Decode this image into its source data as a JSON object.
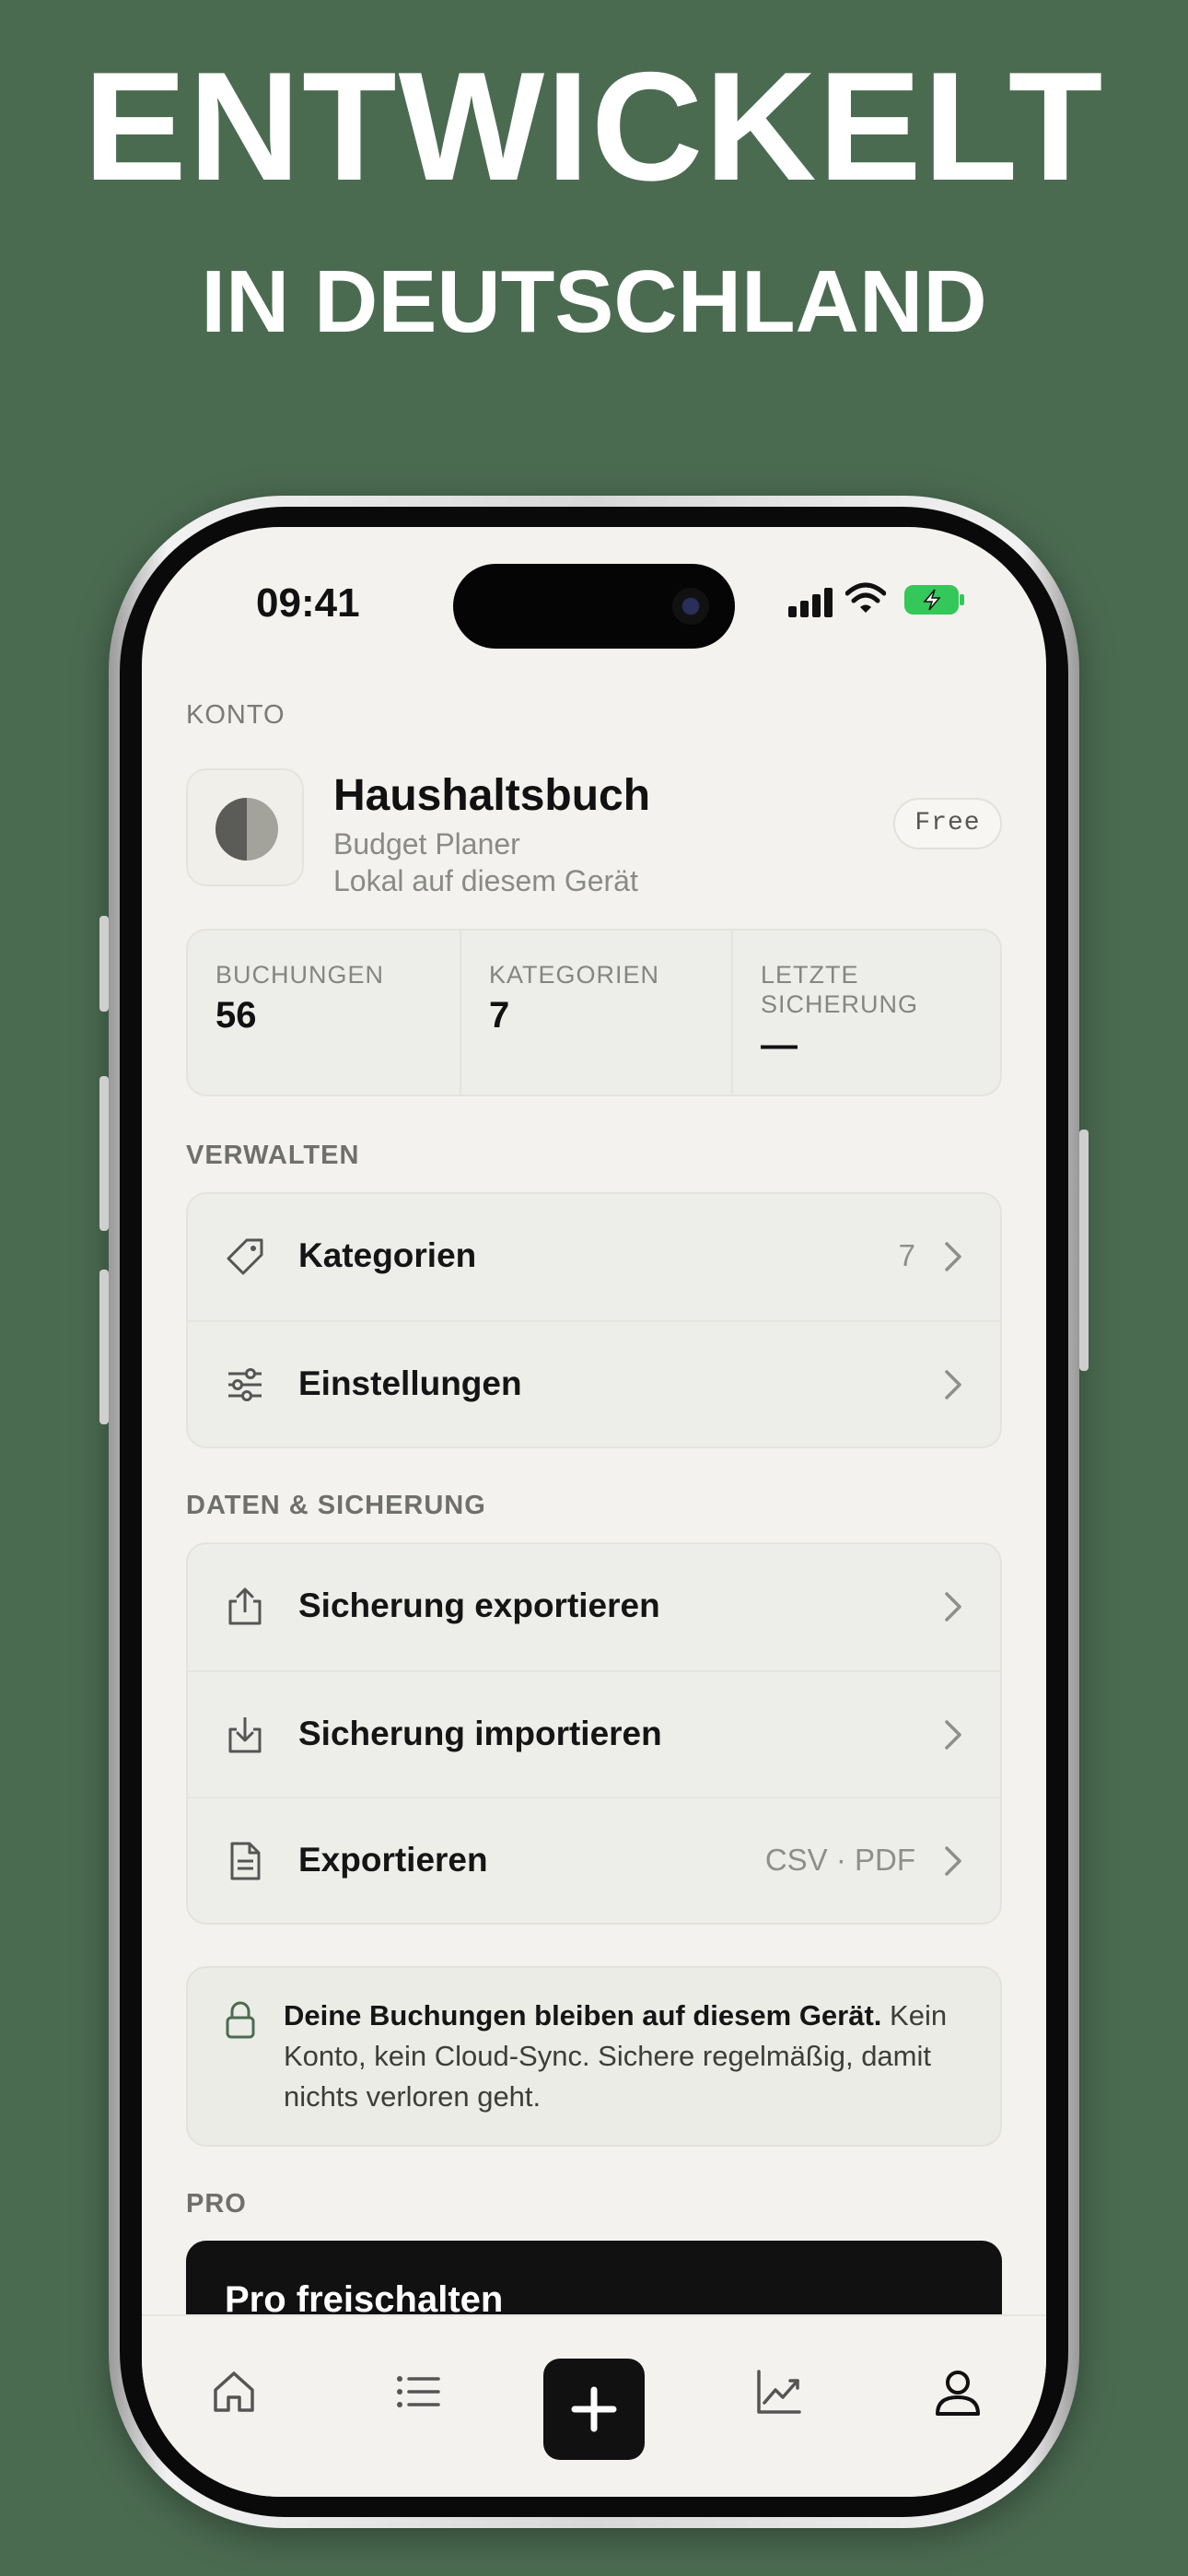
{
  "headline": {
    "line1": "ENTWICKELT",
    "line2": "IN DEUTSCHLAND"
  },
  "status_bar": {
    "time": "09:41"
  },
  "account": {
    "section_label": "KONTO",
    "title": "Haushaltsbuch",
    "subtitle": "Budget Planer",
    "storage": "Lokal auf diesem Gerät",
    "plan_badge": "Free"
  },
  "stats": [
    {
      "label": "BUCHUNGEN",
      "value": "56"
    },
    {
      "label": "KATEGORIEN",
      "value": "7"
    },
    {
      "label_line1": "LETZTE",
      "label_line2": "SICHERUNG",
      "value": "—"
    }
  ],
  "manage": {
    "section_label": "VERWALTEN",
    "items": [
      {
        "label": "Kategorien",
        "meta": "7",
        "icon": "tag-icon"
      },
      {
        "label": "Einstellungen",
        "meta": "",
        "icon": "sliders-icon"
      }
    ]
  },
  "backup": {
    "section_label": "DATEN & SICHERUNG",
    "items": [
      {
        "label": "Sicherung exportieren",
        "meta": "",
        "icon": "share-icon"
      },
      {
        "label": "Sicherung importieren",
        "meta": "",
        "icon": "download-icon"
      },
      {
        "label": "Exportieren",
        "meta": "CSV · PDF",
        "icon": "document-icon"
      }
    ]
  },
  "privacy_note": {
    "bold": "Deine Buchungen bleiben auf diesem Gerät.",
    "text": " Kein Konto, kein Cloud-Sync. Sichere regelmäßig, damit nichts verloren geht."
  },
  "pro": {
    "section_label": "PRO",
    "cta": "Pro freischalten"
  },
  "tabbar": {
    "tabs": [
      "home-icon",
      "list-icon",
      "add-icon",
      "chart-icon",
      "profile-icon"
    ],
    "active": "profile-icon"
  },
  "colors": {
    "background": "#4b6b51",
    "screen": "#f3f2ee",
    "accent_dark": "#111111"
  }
}
